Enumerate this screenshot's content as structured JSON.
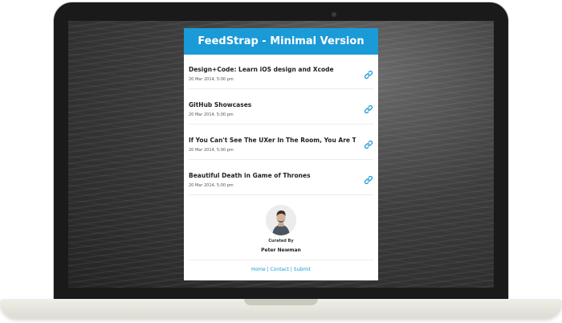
{
  "app": {
    "title": "FeedStrap - Minimal Version",
    "accent_color": "#1b9ad8"
  },
  "feed": {
    "items": [
      {
        "title": "Design+Code: Learn iOS design and Xcode",
        "date": "20 Mar 2014, 5:00 pm",
        "icon": "link-icon"
      },
      {
        "title": "GitHub Showcases",
        "date": "20 Mar 2014, 5:00 pm",
        "icon": "link-icon"
      },
      {
        "title": "If You Can't See The UXer In The Room, You Are The UXer",
        "date": "20 Mar 2014, 5:00 pm",
        "icon": "link-icon"
      },
      {
        "title": "Beautiful Death in Game of Thrones",
        "date": "20 Mar 2014, 5:00 pm",
        "icon": "link-icon"
      }
    ]
  },
  "curator": {
    "label": "Curated By",
    "name": "Peter Newman"
  },
  "footer": {
    "links": [
      "Home",
      "Contact",
      "Submit"
    ],
    "separator": "|"
  }
}
